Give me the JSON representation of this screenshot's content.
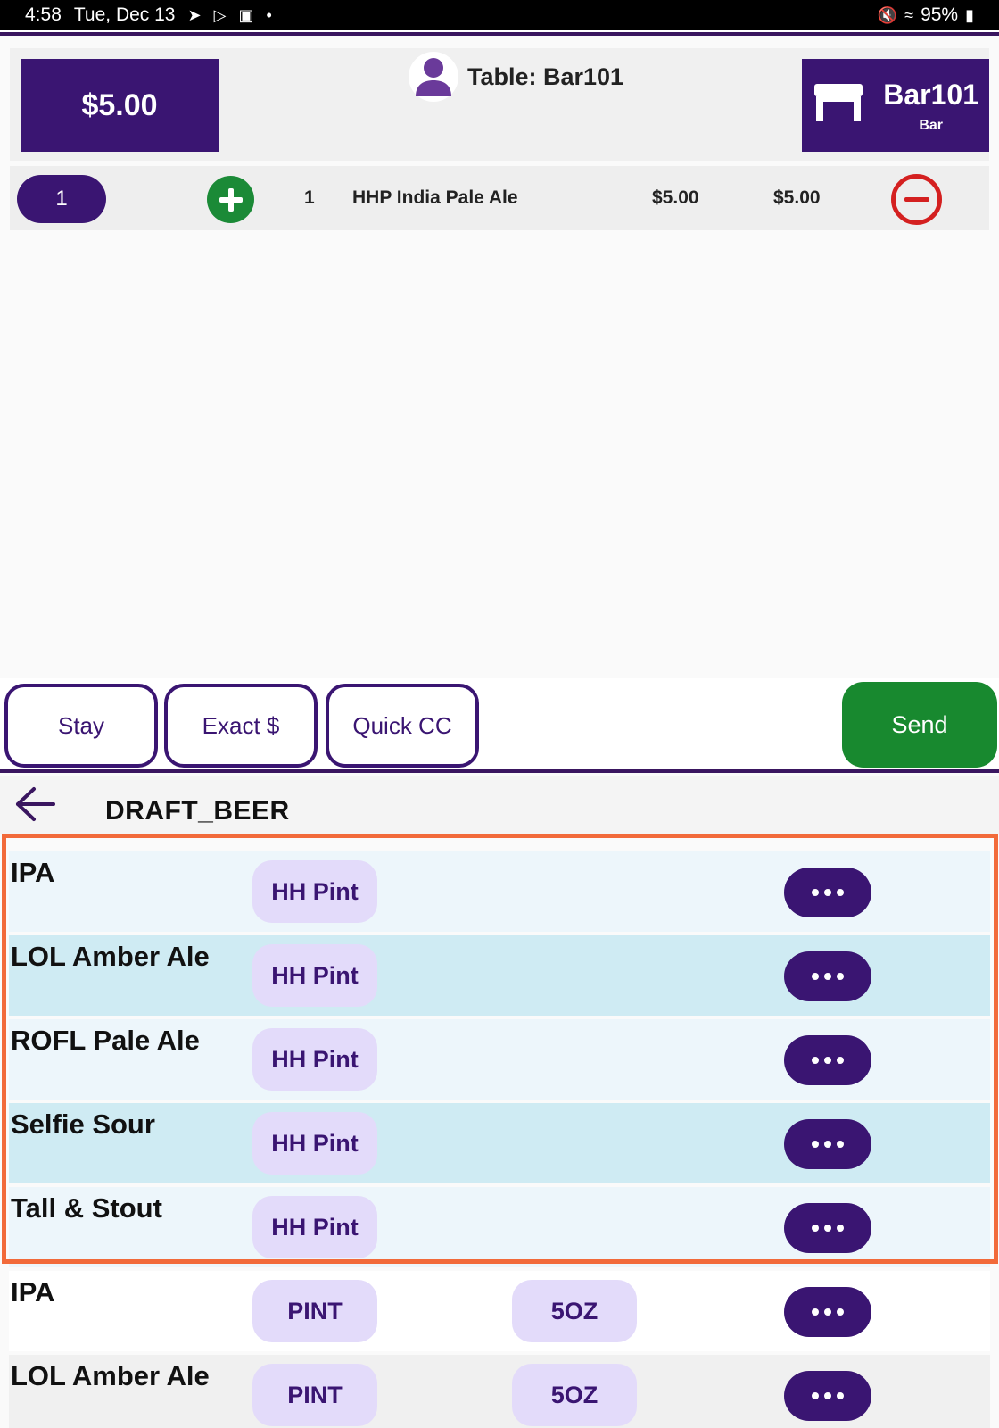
{
  "status_bar": {
    "time": "4:58",
    "date": "Tue, Dec 13",
    "battery": "95%"
  },
  "header": {
    "total": "$5.00",
    "table_label": "Table: Bar101",
    "station_name": "Bar101",
    "station_type": "Bar"
  },
  "order": {
    "seat": "1",
    "items": [
      {
        "qty": "1",
        "name": "HHP India Pale Ale",
        "price": "$5.00",
        "ext_price": "$5.00"
      }
    ]
  },
  "actions": {
    "stay": "Stay",
    "exact": "Exact $",
    "quick_cc": "Quick CC",
    "send": "Send"
  },
  "category": {
    "title": "DRAFT_BEER"
  },
  "menu": [
    {
      "name": "IPA",
      "sizes": [
        "HH Pint"
      ]
    },
    {
      "name": "LOL Amber Ale",
      "sizes": [
        "HH Pint"
      ]
    },
    {
      "name": "ROFL Pale Ale",
      "sizes": [
        "HH Pint"
      ]
    },
    {
      "name": "Selfie Sour",
      "sizes": [
        "HH Pint"
      ]
    },
    {
      "name": "Tall & Stout",
      "sizes": [
        "HH Pint"
      ]
    },
    {
      "name": "IPA",
      "sizes": [
        "PINT",
        "5OZ"
      ]
    },
    {
      "name": "LOL Amber Ale",
      "sizes": [
        "PINT",
        "5OZ"
      ]
    }
  ],
  "colors": {
    "brand_purple": "#3a1572",
    "send_green": "#18892f",
    "remove_red": "#d42020",
    "highlight_orange": "#f26a3a"
  }
}
